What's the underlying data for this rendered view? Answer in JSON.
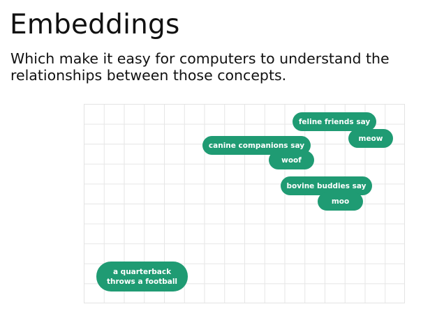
{
  "slide": {
    "title": "Embeddings",
    "subtitle_line1": "Which make it easy for computers to understand the",
    "subtitle_line2": "relationships between those concepts."
  },
  "diagram": {
    "grid_color": "#e6e6e6",
    "pill_color": "#1f9b73",
    "pill_text_color": "#ffffff",
    "labels": {
      "feline": "feline friends say",
      "meow": "meow",
      "canine": "canine companions say",
      "woof": "woof",
      "bovine": "bovine buddies say",
      "moo": "moo",
      "quarterback_line1": "a quarterback",
      "quarterback_line2": "throws a football"
    }
  }
}
